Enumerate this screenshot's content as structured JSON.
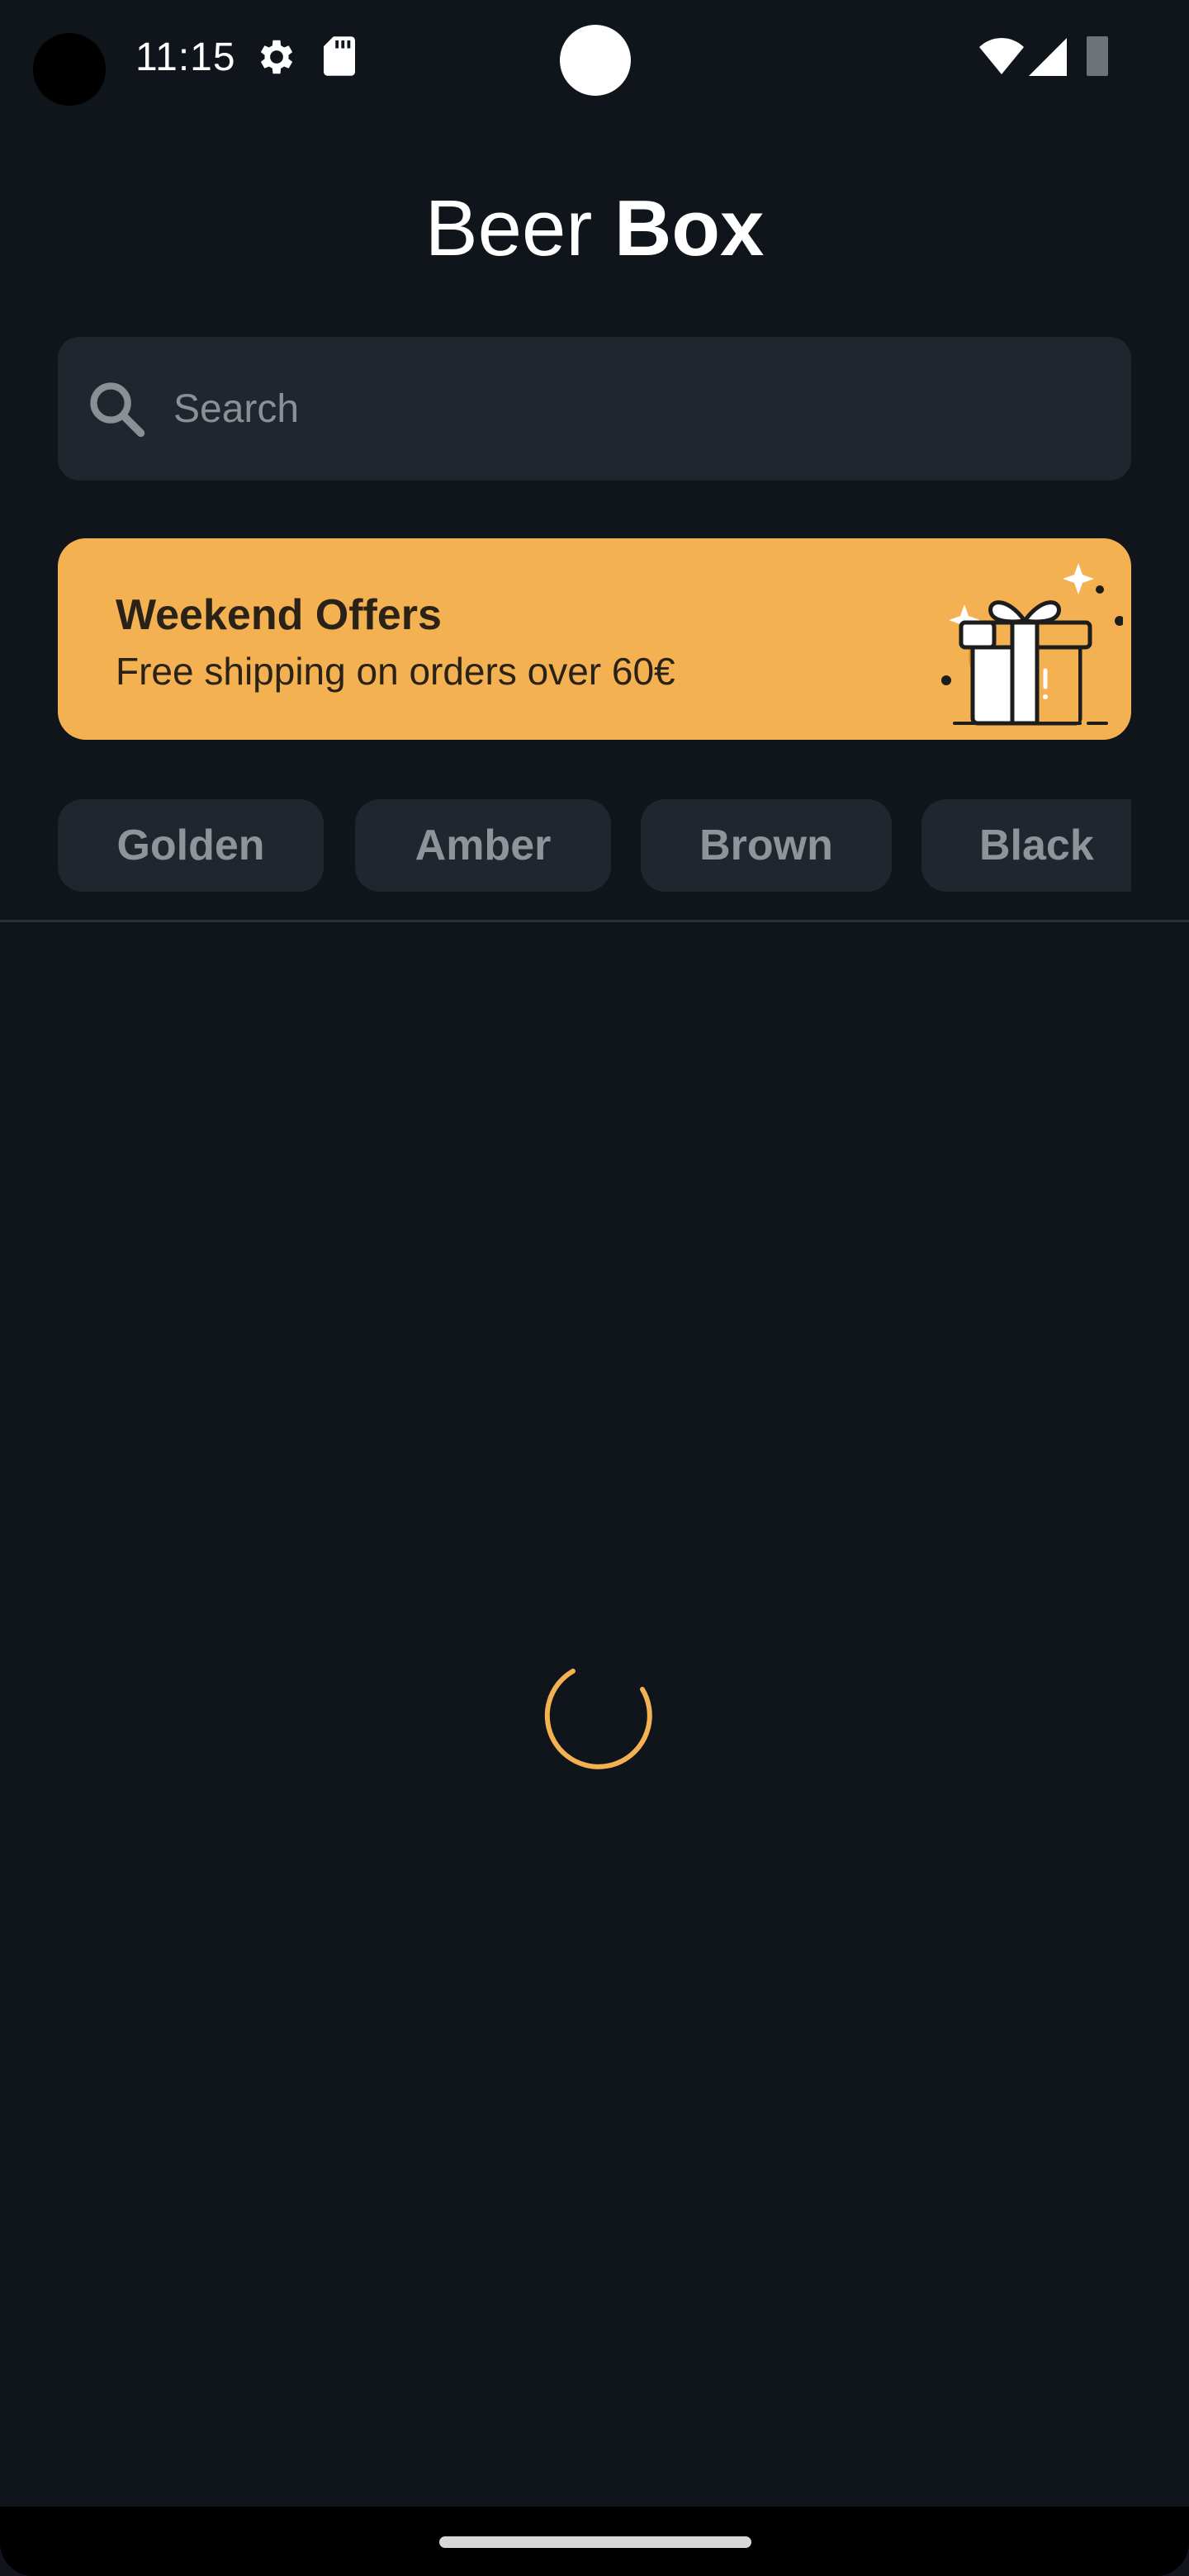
{
  "status_bar": {
    "time": "11:15",
    "icons": [
      "settings-icon",
      "sd-card-icon",
      "wifi-icon",
      "cell-signal-icon",
      "battery-icon"
    ]
  },
  "header": {
    "title_regular": "Beer",
    "title_bold": "Box"
  },
  "search": {
    "placeholder": "Search",
    "value": "",
    "icon": "search-icon"
  },
  "offer": {
    "title": "Weekend Offers",
    "subtitle": "Free shipping on orders over 60€",
    "icon": "gift-icon",
    "background_color": "#F3B152"
  },
  "filters": {
    "chips": [
      {
        "label": "Golden"
      },
      {
        "label": "Amber"
      },
      {
        "label": "Brown"
      },
      {
        "label": "Black"
      }
    ]
  },
  "content": {
    "state": "loading",
    "spinner_color": "#F3B152"
  },
  "colors": {
    "background": "#0F151B",
    "surface": "#1F262D",
    "accent": "#F3B152",
    "text_primary": "#FFFFFF",
    "text_muted": "#8E949A"
  }
}
